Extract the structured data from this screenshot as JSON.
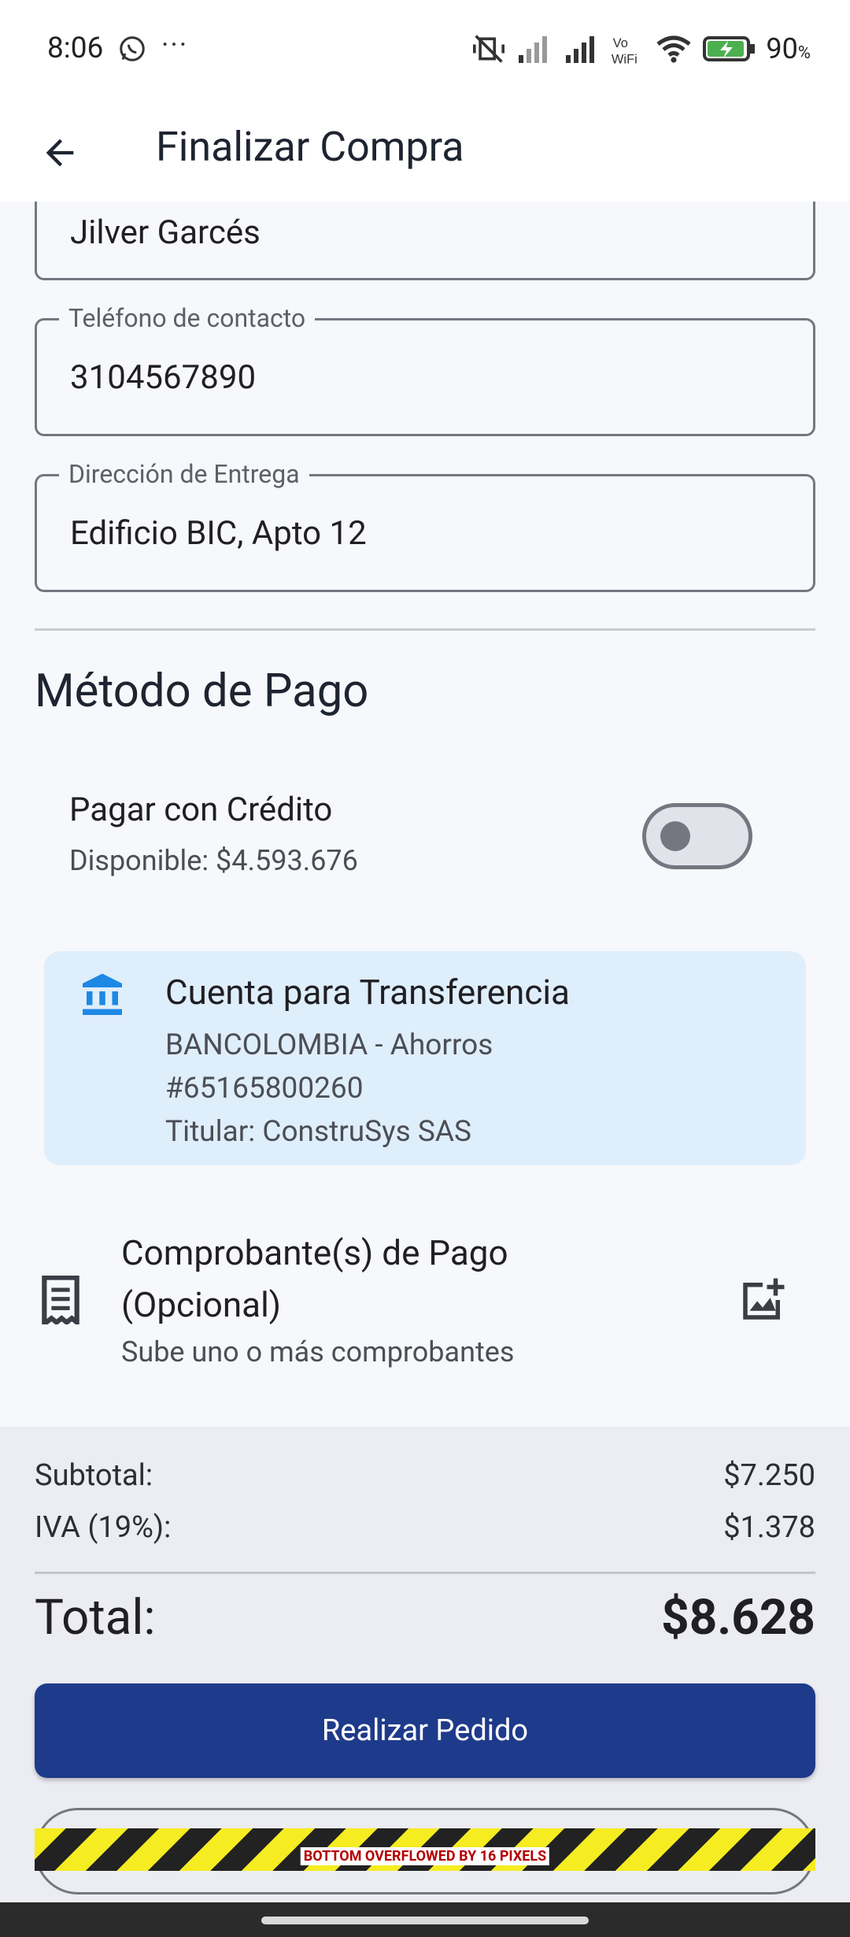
{
  "status_bar": {
    "time": "8:06",
    "battery": "90",
    "battery_unit": "%"
  },
  "app_bar": {
    "title": "Finalizar Compra"
  },
  "form": {
    "name_value": "Jilver Garcés",
    "phone_label": "Teléfono de contacto",
    "phone_value": "3104567890",
    "address_label": "Dirección de Entrega",
    "address_value": "Edificio BIC, Apto 12"
  },
  "payment": {
    "section_title": "Método de Pago",
    "credit_title": "Pagar con Crédito",
    "credit_available": "Disponible: $4.593.676",
    "credit_enabled": false,
    "transfer": {
      "title": "Cuenta para Transferencia",
      "bank": "BANCOLOMBIA - Ahorros",
      "account": "#65165800260",
      "holder": "Titular: ConstruSys SAS"
    },
    "receipt": {
      "title": "Comprobante(s) de Pago (Opcional)",
      "subtitle": "Sube uno o más comprobantes"
    }
  },
  "summary": {
    "subtotal_label": "Subtotal:",
    "subtotal_value": "$7.250",
    "iva_label": "IVA (19%):",
    "iva_value": "$1.378",
    "total_label": "Total:",
    "total_value": "$8.628",
    "primary_button": "Realizar Pedido",
    "overflow_message": "BOTTOM OVERFLOWED BY 16 PIXELS"
  },
  "colors": {
    "primary": "#1e3a8a",
    "info_card": "#dfeefb",
    "bank_icon": "#1e88e5",
    "summary_bg": "#ececf3"
  }
}
